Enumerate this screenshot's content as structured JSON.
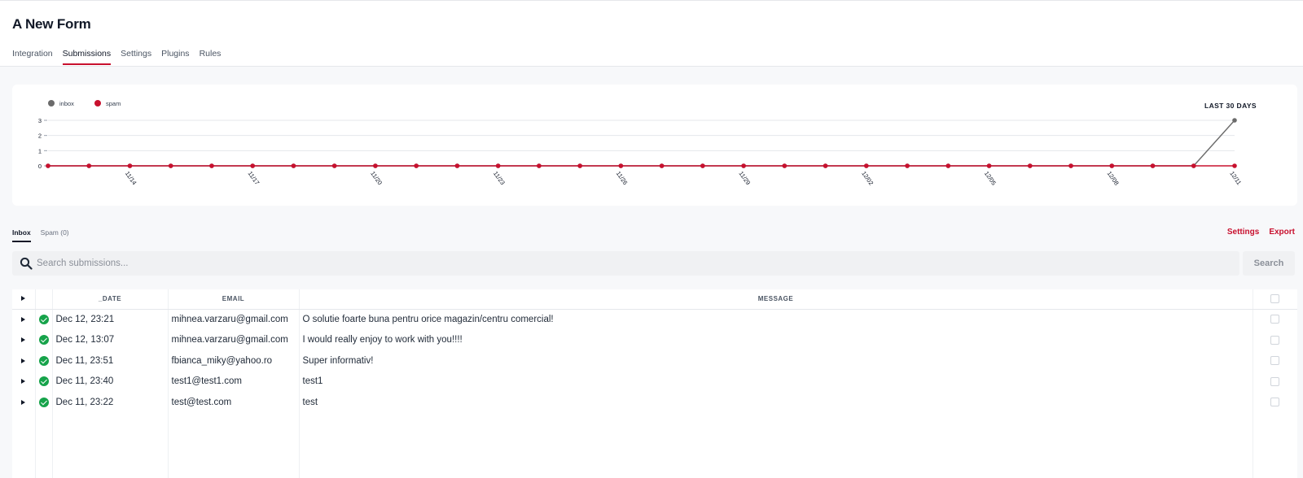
{
  "header": {
    "title": "A New Form",
    "tabs": [
      {
        "label": "Integration",
        "active": false
      },
      {
        "label": "Submissions",
        "active": true
      },
      {
        "label": "Settings",
        "active": false
      },
      {
        "label": "Plugins",
        "active": false
      },
      {
        "label": "Rules",
        "active": false
      }
    ]
  },
  "colors": {
    "accent": "#c8102e",
    "inbox": "#6b6b6b",
    "spam": "#c8102e",
    "status_ok": "#16a34a"
  },
  "chart_range_label": "LAST 30 DAYS",
  "chart_data": {
    "type": "line",
    "x": [
      "11/12",
      "11/13",
      "11/14",
      "11/15",
      "11/16",
      "11/17",
      "11/18",
      "11/19",
      "11/20",
      "11/21",
      "11/22",
      "11/23",
      "11/24",
      "11/25",
      "11/26",
      "11/27",
      "11/28",
      "11/29",
      "11/30",
      "12/01",
      "12/02",
      "12/03",
      "12/04",
      "12/05",
      "12/06",
      "12/07",
      "12/08",
      "12/09",
      "12/10",
      "12/11"
    ],
    "x_tick_labels": [
      "11/14",
      "11/17",
      "11/20",
      "11/23",
      "11/26",
      "11/29",
      "12/02",
      "12/05",
      "12/08",
      "12/11"
    ],
    "series": [
      {
        "name": "inbox",
        "color": "#6b6b6b",
        "values": [
          0,
          0,
          0,
          0,
          0,
          0,
          0,
          0,
          0,
          0,
          0,
          0,
          0,
          0,
          0,
          0,
          0,
          0,
          0,
          0,
          0,
          0,
          0,
          0,
          0,
          0,
          0,
          0,
          0,
          3
        ]
      },
      {
        "name": "spam",
        "color": "#c8102e",
        "values": [
          0,
          0,
          0,
          0,
          0,
          0,
          0,
          0,
          0,
          0,
          0,
          0,
          0,
          0,
          0,
          0,
          0,
          0,
          0,
          0,
          0,
          0,
          0,
          0,
          0,
          0,
          0,
          0,
          0,
          0
        ]
      }
    ],
    "y_ticks": [
      0,
      1,
      2,
      3
    ],
    "ylim": [
      0,
      3
    ],
    "legend_position": "top-left",
    "grid": true
  },
  "submissions": {
    "tabs": [
      {
        "label": "Inbox",
        "active": true
      },
      {
        "label": "Spam (0)",
        "active": false
      }
    ],
    "actions": {
      "settings": "Settings",
      "export": "Export"
    },
    "search": {
      "placeholder": "Search submissions...",
      "value": "",
      "button": "Search"
    },
    "columns": {
      "date": "_DATE",
      "email": "EMAIL",
      "message": "MESSAGE"
    },
    "rows": [
      {
        "date": "Dec 12, 23:21",
        "email": "mihnea.varzaru@gmail.com",
        "message": "O solutie foarte buna pentru orice magazin/centru comercial!"
      },
      {
        "date": "Dec 12, 13:07",
        "email": "mihnea.varzaru@gmail.com",
        "message": "I would really enjoy to work with you!!!!"
      },
      {
        "date": "Dec 11, 23:51",
        "email": "fbianca_miky@yahoo.ro",
        "message": "Super informativ!"
      },
      {
        "date": "Dec 11, 23:40",
        "email": "test1@test1.com",
        "message": "test1"
      },
      {
        "date": "Dec 11, 23:22",
        "email": "test@test.com",
        "message": "test"
      }
    ]
  }
}
